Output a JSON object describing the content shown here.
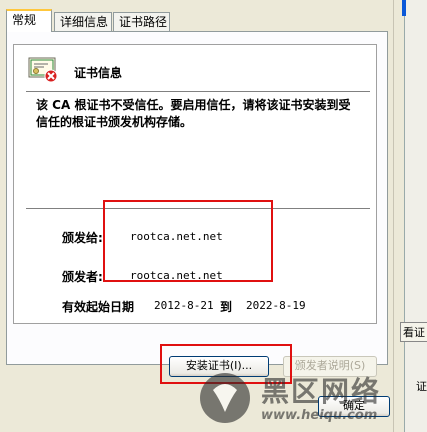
{
  "tabs": [
    {
      "label": "常规"
    },
    {
      "label": "详细信息"
    },
    {
      "label": "证书路径"
    }
  ],
  "cert_info": {
    "title": "证书信息",
    "warning": "该 CA 根证书不受信任。要启用信任，请将该证书安装到受信任的根证书颁发机构存储。"
  },
  "fields": {
    "issued_to_label": "颁发给:",
    "issued_to_value": "rootca.net.net",
    "issued_by_label": "颁发者:",
    "issued_by_value": "rootca.net.net",
    "validity_label": "有效起始日期",
    "valid_from": "2012-8-21",
    "to_label": "到",
    "valid_to": "2022-8-19"
  },
  "buttons": {
    "install": "安装证书(I)...",
    "issuer_statement": "颁发者说明(S)",
    "ok": "确定"
  },
  "background_window": {
    "partial_text_1": "看证",
    "partial_text_2": "证"
  },
  "watermark": {
    "name": "黑区网络",
    "url": "www.heiqu.com"
  },
  "colors": {
    "highlight_box": "#e01010",
    "tab_accent": "#ffc73c"
  }
}
